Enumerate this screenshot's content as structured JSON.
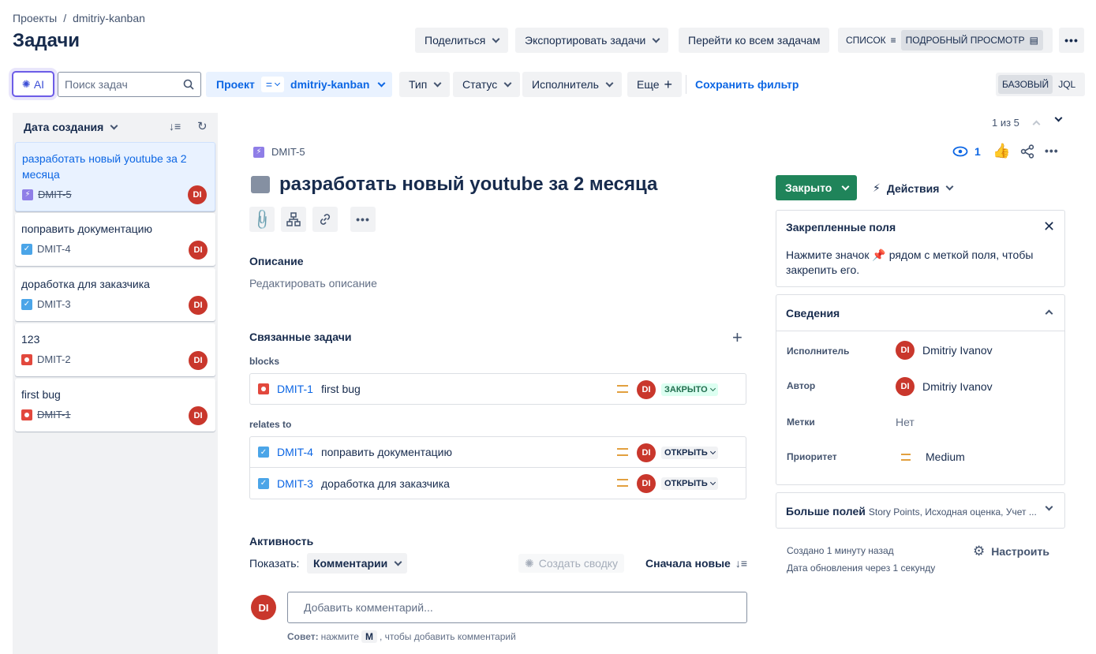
{
  "breadcrumb": {
    "projects": "Проекты",
    "sep": "/",
    "project": "dmitriy-kanban"
  },
  "page_title": "Задачи",
  "top_actions": {
    "share": "Поделиться",
    "export": "Экспортировать задачи",
    "all_issues": "Перейти ко всем задачам",
    "list_view": "СПИСОК",
    "detail_view": "ПОДРОБНЫЙ ПРОСМОТР"
  },
  "filters": {
    "ai": "AI",
    "search_placeholder": "Поиск задач",
    "project_label": "Проект",
    "project_op": "=",
    "project_value": "dmitriy-kanban",
    "type": "Тип",
    "status": "Статус",
    "assignee": "Исполнитель",
    "more": "Еще",
    "save_filter": "Сохранить фильтр",
    "basic": "БАЗОВЫЙ",
    "jql": "JQL"
  },
  "list": {
    "sort_label": "Дата создания",
    "cards": [
      {
        "title": "разработать новый youtube за 2 месяца",
        "key": "DMIT-5",
        "type": "story",
        "done": true,
        "avatar": "DI"
      },
      {
        "title": "поправить документацию",
        "key": "DMIT-4",
        "type": "task",
        "done": false,
        "avatar": "DI"
      },
      {
        "title": "доработка для заказчика",
        "key": "DMIT-3",
        "type": "task",
        "done": false,
        "avatar": "DI"
      },
      {
        "title": "123",
        "key": "DMIT-2",
        "type": "bug",
        "done": false,
        "avatar": "DI"
      },
      {
        "title": "first bug",
        "key": "DMIT-1",
        "type": "bug",
        "done": true,
        "avatar": "DI"
      }
    ]
  },
  "pager": {
    "text": "1 из 5"
  },
  "issue": {
    "key": "DMIT-5",
    "title": "разработать новый youtube за 2 месяца",
    "watchers": "1",
    "description_label": "Описание",
    "description_placeholder": "Редактировать описание",
    "linked_label": "Связанные задачи",
    "groups": [
      {
        "label": "blocks",
        "items": [
          {
            "key": "DMIT-1",
            "title": "first bug",
            "type": "bug",
            "status": "ЗАКРЫТО",
            "avatar": "DI"
          }
        ]
      },
      {
        "label": "relates to",
        "items": [
          {
            "key": "DMIT-4",
            "title": "поправить документацию",
            "type": "task",
            "status": "ОТКРЫТЬ",
            "avatar": "DI"
          },
          {
            "key": "DMIT-3",
            "title": "доработка для заказчика",
            "type": "task",
            "status": "ОТКРЫТЬ",
            "avatar": "DI"
          }
        ]
      }
    ],
    "activity_label": "Активность",
    "show_label": "Показать:",
    "show_value": "Комментарии",
    "summarize": "Создать сводку",
    "order": "Сначала новые",
    "comment_placeholder": "Добавить комментарий...",
    "tip_bold": "Совет:",
    "tip_pre": "нажмите",
    "tip_key": "M",
    "tip_post": ", чтобы добавить комментарий",
    "my_avatar": "DI"
  },
  "side": {
    "status": "Закрыто",
    "actions": "Действия",
    "pinned_title": "Закрепленные поля",
    "pinned_text_1": "Нажмите значок",
    "pinned_text_2": "рядом с меткой поля, чтобы закрепить его.",
    "details_title": "Сведения",
    "assignee_label": "Исполнитель",
    "assignee_value": "Dmitriy Ivanov",
    "reporter_label": "Автор",
    "reporter_value": "Dmitriy Ivanov",
    "labels_label": "Метки",
    "labels_value": "Нет",
    "priority_label": "Приоритет",
    "priority_value": "Medium",
    "more_fields": "Больше полей",
    "more_fields_hint": "Story Points, Исходная оценка, Учет ...",
    "created": "Создано 1 минуту назад",
    "updated": "Дата обновления через 1 секунду",
    "configure": "Настроить",
    "avatar": "DI"
  },
  "colors": {
    "accent": "#0c66e4",
    "closed": "#1f845a",
    "avatar": "#c9372c",
    "priority": "#e2a03f"
  }
}
